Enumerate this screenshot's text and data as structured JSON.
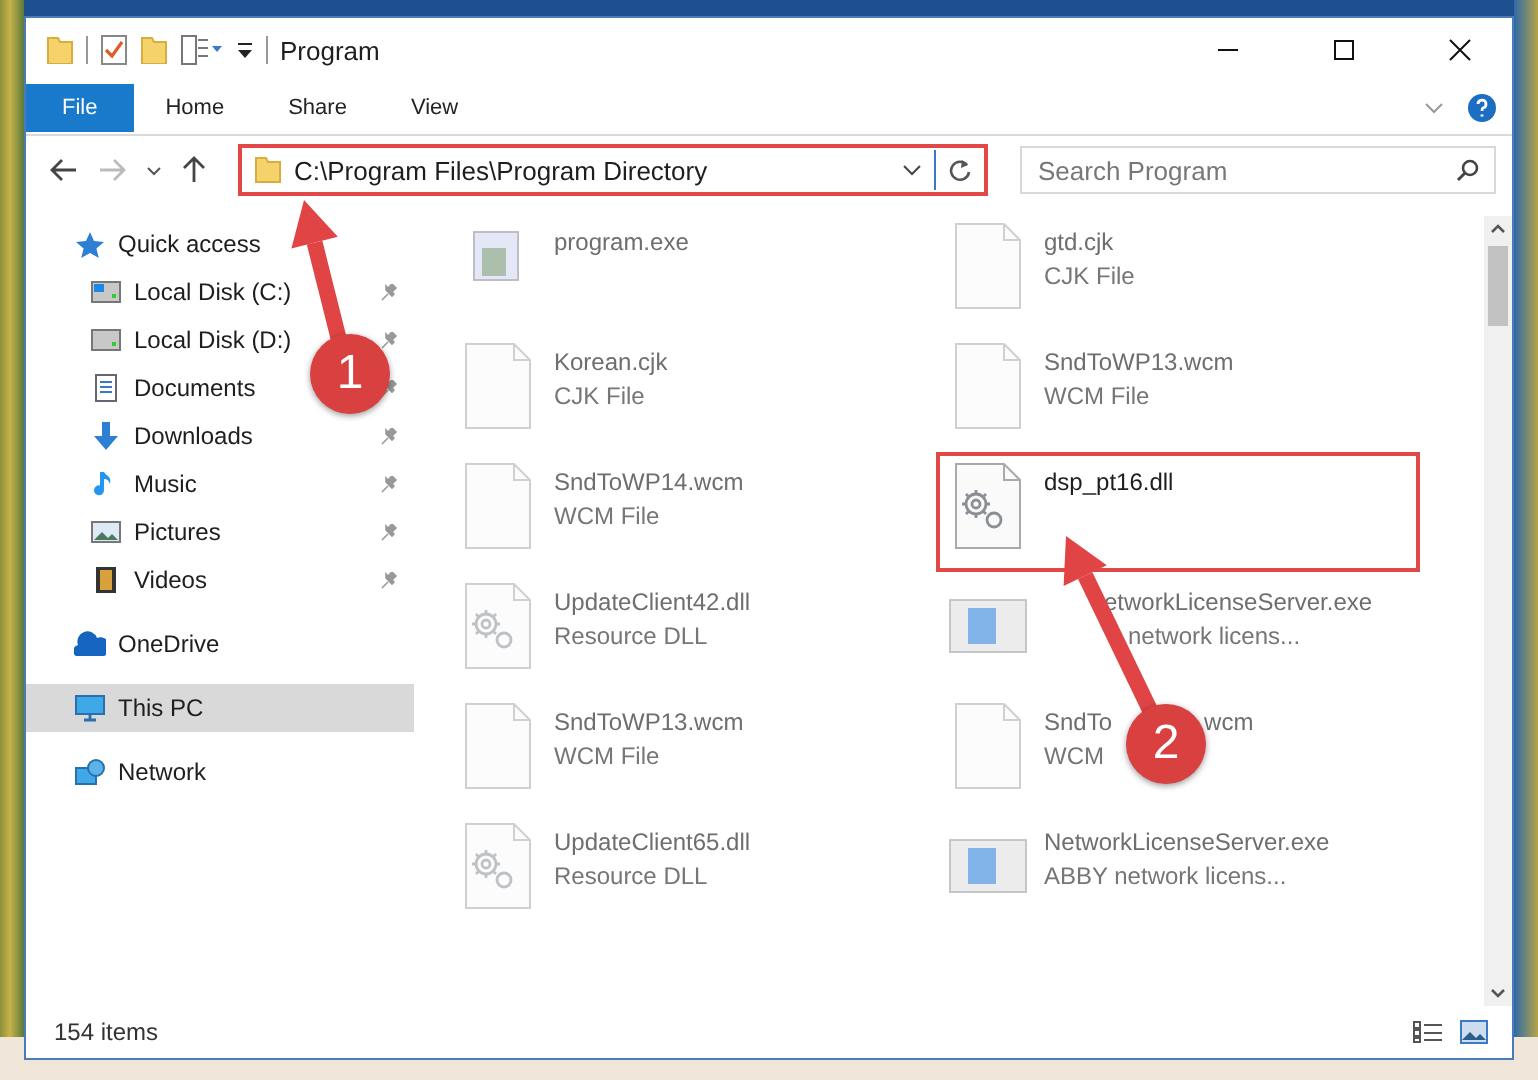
{
  "window": {
    "title": "Program"
  },
  "tabs": [
    {
      "label": "File",
      "selected": true
    },
    {
      "label": "Home",
      "selected": false
    },
    {
      "label": "Share",
      "selected": false
    },
    {
      "label": "View",
      "selected": false
    }
  ],
  "address": {
    "path": "C:\\Program Files\\Program Directory",
    "highlighted": true
  },
  "search": {
    "placeholder": "Search Program"
  },
  "sidebar": {
    "items": [
      {
        "label": "Quick access",
        "kind": "quick",
        "selected": false,
        "children": [
          {
            "label": "Local Disk (C:)",
            "kind": "diskc",
            "pinned": true,
            "selected": false
          },
          {
            "label": "Local Disk (D:)",
            "kind": "disk",
            "pinned": true,
            "selected": false
          },
          {
            "label": "Documents",
            "kind": "docs",
            "pinned": true,
            "selected": false
          },
          {
            "label": "Downloads",
            "kind": "down",
            "pinned": true,
            "selected": false
          },
          {
            "label": "Music",
            "kind": "music",
            "pinned": true,
            "selected": false
          },
          {
            "label": "Pictures",
            "kind": "pics",
            "pinned": true,
            "selected": false
          },
          {
            "label": "Videos",
            "kind": "videos",
            "pinned": true,
            "selected": false
          }
        ]
      },
      {
        "label": "OneDrive",
        "kind": "cloud",
        "selected": false
      },
      {
        "label": "This PC",
        "kind": "pc",
        "selected": true
      },
      {
        "label": "Network",
        "kind": "network",
        "selected": false
      }
    ]
  },
  "files": [
    {
      "name": "program.exe",
      "kind": "exe",
      "dimmed": true,
      "highlighted": false
    },
    {
      "name": "gtd.cjk",
      "type": "CJK File",
      "kind": "blank",
      "dimmed": true,
      "highlighted": false
    },
    {
      "name": "Korean.cjk",
      "type": "CJK File",
      "kind": "blank",
      "dimmed": true,
      "highlighted": false
    },
    {
      "name": "SndToWP13.wcm",
      "type": "WCM File",
      "kind": "blank",
      "dimmed": true,
      "highlighted": false
    },
    {
      "name": "SndToWP14.wcm",
      "type": "WCM File",
      "kind": "blank",
      "dimmed": true,
      "highlighted": false
    },
    {
      "name": "dsp_pt16.dll",
      "kind": "gear",
      "dimmed": false,
      "highlighted": true
    },
    {
      "name": "UpdateClient42.dll",
      "type": "Resource DLL",
      "kind": "resource",
      "dimmed": true,
      "highlighted": false
    },
    {
      "name": "etworkLicenseServer.exe",
      "type": "network licens...",
      "kind": "app",
      "dimmed": true,
      "highlighted": false
    },
    {
      "name": "SndToWP13.wcm",
      "type": "WCM File",
      "kind": "blank",
      "dimmed": true,
      "highlighted": false
    },
    {
      "name": "SndTo",
      "name_tail": "wcm",
      "type": "WCM",
      "kind": "blank",
      "dimmed": true,
      "highlighted": false
    },
    {
      "name": "UpdateClient65.dll",
      "type": "Resource DLL",
      "kind": "resource",
      "dimmed": true,
      "highlighted": false
    },
    {
      "name": "NetworkLicenseServer.exe",
      "type": "ABBY network licens...",
      "kind": "app",
      "dimmed": true,
      "highlighted": false
    }
  ],
  "status_bar": {
    "count": "154 items"
  },
  "annotations": [
    {
      "label": "1"
    },
    {
      "label": "2"
    }
  ]
}
